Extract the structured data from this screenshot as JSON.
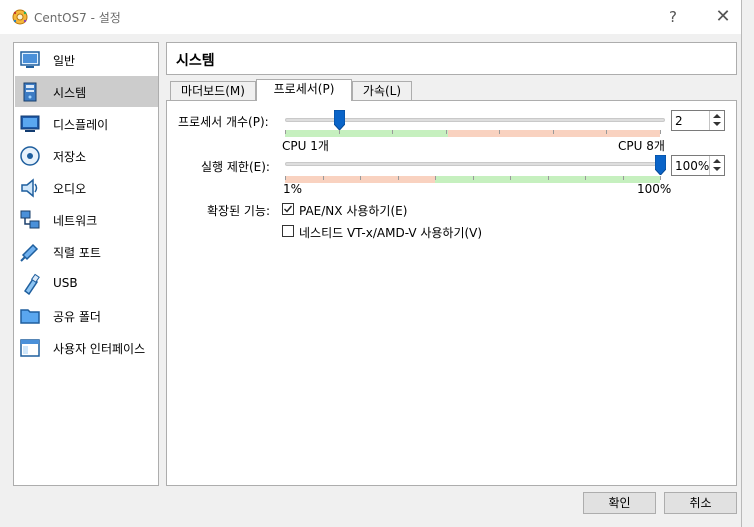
{
  "window": {
    "title": "CentOS7 - 설정",
    "help_glyph": "?",
    "close_glyph": "✕"
  },
  "sidebar": {
    "items": [
      {
        "label": "일반",
        "icon": "general-icon"
      },
      {
        "label": "시스템",
        "icon": "system-icon",
        "selected": true
      },
      {
        "label": "디스플레이",
        "icon": "display-icon"
      },
      {
        "label": "저장소",
        "icon": "storage-icon"
      },
      {
        "label": "오디오",
        "icon": "audio-icon"
      },
      {
        "label": "네트워크",
        "icon": "network-icon"
      },
      {
        "label": "직렬 포트",
        "icon": "serial-port-icon"
      },
      {
        "label": "USB",
        "icon": "usb-icon"
      },
      {
        "label": "공유 폴더",
        "icon": "shared-folder-icon"
      },
      {
        "label": "사용자 인터페이스",
        "icon": "user-interface-icon"
      }
    ]
  },
  "header": {
    "title": "시스템"
  },
  "tabs": [
    {
      "label": "마더보드(M)"
    },
    {
      "label": "프로세서(P)",
      "active": true
    },
    {
      "label": "가속(L)"
    }
  ],
  "processor": {
    "cpu_count_label": "프로세서 개수(P):",
    "cpu_count_value": "2",
    "cpu_min_label": "CPU 1개",
    "cpu_max_label": "CPU 8개",
    "cpu_count_fraction": 0.143,
    "exec_cap_label": "실행 제한(E):",
    "exec_cap_value": "100%",
    "exec_min_label": "1%",
    "exec_max_label": "100%",
    "exec_cap_fraction": 1.0,
    "extended_features_label": "확장된 기능:",
    "pae_label": "PAE/NX 사용하기(E)",
    "pae_checked": true,
    "nested_label": "네스티드 VT-x/AMD-V 사용하기(V)",
    "nested_checked": false
  },
  "buttons": {
    "ok": "확인",
    "cancel": "취소"
  },
  "colors": {
    "accent": "#0a64c8",
    "band_green": "#c6f0bf",
    "band_red": "#f9d2c0"
  }
}
